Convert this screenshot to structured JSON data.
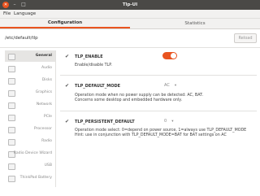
{
  "window": {
    "title": "Tlp-UI"
  },
  "menu": [
    "File",
    "Language"
  ],
  "tabs": [
    "Configuration",
    "Statistics"
  ],
  "path": "/etc/default/tlp",
  "reload_label": "Reload",
  "sidebar": {
    "items": [
      {
        "label": "General",
        "active": true
      },
      {
        "label": "Audio"
      },
      {
        "label": "Disks"
      },
      {
        "label": "Graphics"
      },
      {
        "label": "Network"
      },
      {
        "label": "PCIe"
      },
      {
        "label": "Processor"
      },
      {
        "label": "Radio"
      },
      {
        "label": "Radio Device Wizard"
      },
      {
        "label": "USB"
      },
      {
        "label": "ThinkPad Battery"
      }
    ]
  },
  "settings": [
    {
      "name": "TLP_ENABLE",
      "control": "toggle",
      "value": true,
      "description": [
        "Enable/disable TLP."
      ]
    },
    {
      "name": "TLP_DEFAULT_MODE",
      "control": "select",
      "value": "AC",
      "description": [
        "Operation mode when no power supply can be detected: AC, BAT.",
        "Concerns some desktop and embedded hardware only."
      ]
    },
    {
      "name": "TLP_PERSISTENT_DEFAULT",
      "control": "select",
      "value": "0",
      "description": [
        "Operation mode select: 0=depend on power source, 1=always use TLP_DEFAULT_MODE",
        "Hint: use in conjunction with TLP_DEFAULT_MODE=BAT for BAT settings on AC"
      ]
    }
  ],
  "colors": {
    "accent": "#e95420",
    "titlebar": "#4a4946"
  }
}
